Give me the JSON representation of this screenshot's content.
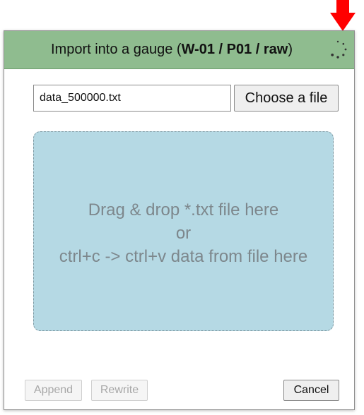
{
  "dialog": {
    "title_prefix": "Import into a gauge (",
    "title_bold": "W-01 / P01 / raw",
    "title_suffix": ")"
  },
  "file_input": {
    "value": "data_500000.txt"
  },
  "choose_button": {
    "label": "Choose a file"
  },
  "drop_zone": {
    "line1": "Drag & drop *.txt file here",
    "line2": "or",
    "line3": "ctrl+c -> ctrl+v data from file here"
  },
  "footer": {
    "append_label": "Append",
    "rewrite_label": "Rewrite",
    "cancel_label": "Cancel"
  },
  "colors": {
    "header_bg": "#8fbc8f",
    "drop_zone_bg": "#b5d9e4",
    "annotation_arrow": "#ff0000"
  },
  "icons": {
    "annotation": "red-down-arrow-icon",
    "loading": "loading-spinner-icon"
  }
}
